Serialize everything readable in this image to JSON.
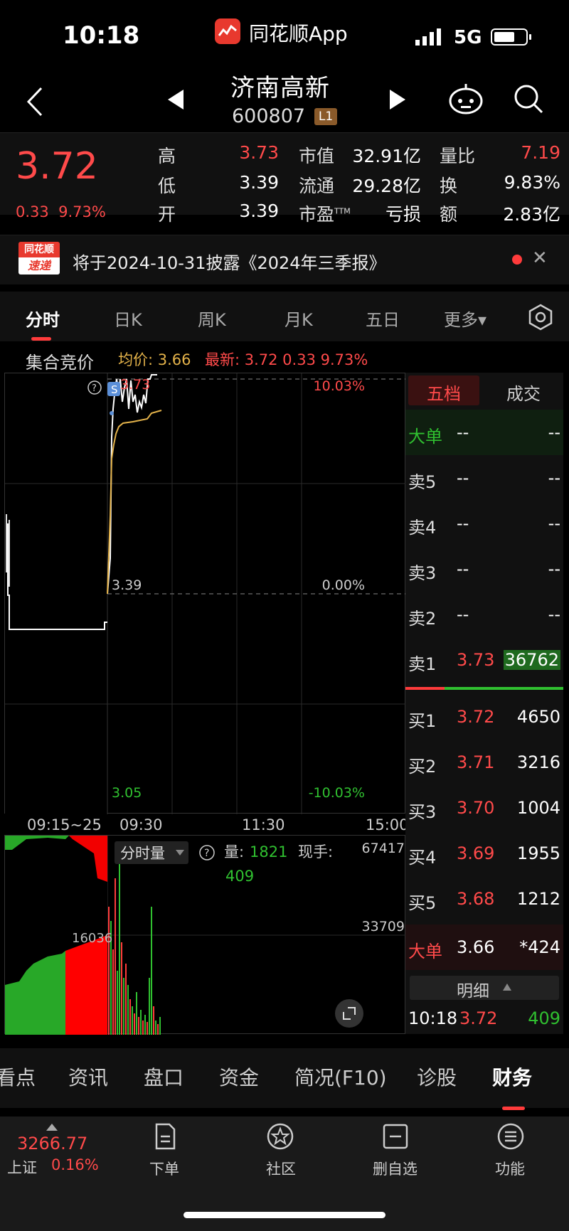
{
  "status_bar": {
    "time": "10:18",
    "app_name": "同花顺App",
    "network": "5G"
  },
  "header": {
    "stock_name": "济南高新",
    "stock_code": "600807",
    "level": "L1"
  },
  "quote": {
    "price": "3.72",
    "change": "0.33",
    "change_pct": "9.73%",
    "rows": [
      {
        "l1": "高",
        "v1": "3.73",
        "l2": "市值",
        "v2": "32.91亿",
        "l3": "量比",
        "v3": "7.19"
      },
      {
        "l1": "低",
        "v1": "3.39",
        "l2": "流通",
        "v2": "29.28亿",
        "l3": "换",
        "v3": "9.83%"
      },
      {
        "l1": "开",
        "v1": "3.39",
        "l2": "市盈",
        "l2_sup": "TTM",
        "v2": "亏损",
        "l3": "额",
        "v3": "2.83亿"
      }
    ]
  },
  "notice": {
    "logo_top": "同花顺",
    "logo_bottom": "速递",
    "text": "将于2024-10-31披露《2024年三季报》"
  },
  "tabs": [
    "分时",
    "日K",
    "周K",
    "月K",
    "五日",
    "更多▾"
  ],
  "chart_header": {
    "auction": "集合竞价",
    "avg": "均价: 3.66",
    "latest": "最新: 3.72  0.33  9.73%"
  },
  "price_chart": {
    "top_price": "3.73",
    "top_pct": "10.03%",
    "mid_price": "3.39",
    "mid_pct": "0.00%",
    "bottom_price": "3.05",
    "bottom_pct": "-10.03%",
    "help": "?",
    "marker": "S",
    "time_labels": [
      "09:15~25",
      "09:30",
      "11:30",
      "15:00"
    ]
  },
  "volume_chart": {
    "selector": "分时量",
    "vol_label": "量:",
    "vol_value": "1821",
    "now_label": "现手:",
    "now_value": "409",
    "max": "67417",
    "mid": "33709",
    "auction_mid": "16036"
  },
  "order_book": {
    "tabs": [
      "五档",
      "成交"
    ],
    "big_top": {
      "label": "大单",
      "price": "--",
      "vol": "--"
    },
    "sells": [
      {
        "label": "卖5",
        "price": "--",
        "vol": "--"
      },
      {
        "label": "卖4",
        "price": "--",
        "vol": "--"
      },
      {
        "label": "卖3",
        "price": "--",
        "vol": "--"
      },
      {
        "label": "卖2",
        "price": "--",
        "vol": "--"
      },
      {
        "label": "卖1",
        "price": "3.73",
        "vol": "36762"
      }
    ],
    "buys": [
      {
        "label": "买1",
        "price": "3.72",
        "vol": "4650"
      },
      {
        "label": "买2",
        "price": "3.71",
        "vol": "3216"
      },
      {
        "label": "买3",
        "price": "3.70",
        "vol": "1004"
      },
      {
        "label": "买4",
        "price": "3.69",
        "vol": "1955"
      },
      {
        "label": "买5",
        "price": "3.68",
        "vol": "1212"
      }
    ],
    "big_bottom": {
      "label": "大单",
      "price": "3.66",
      "vol": "*424"
    },
    "detail_label": "明细",
    "last_trade": {
      "time": "10:18",
      "price": "3.72",
      "vol": "409"
    }
  },
  "bottom_tabs": [
    "看点",
    "资讯",
    "盘口",
    "资金",
    "简况(F10)",
    "诊股",
    "财务"
  ],
  "footer": {
    "index_value": "3266.77",
    "index_name": "上证",
    "index_pct": "0.16%",
    "items": [
      "下单",
      "社区",
      "删自选",
      "功能"
    ]
  },
  "colors": {
    "up": "#ff4a4a",
    "down": "#30c030",
    "avg_line": "#e3b24a",
    "bg": "#000000"
  }
}
